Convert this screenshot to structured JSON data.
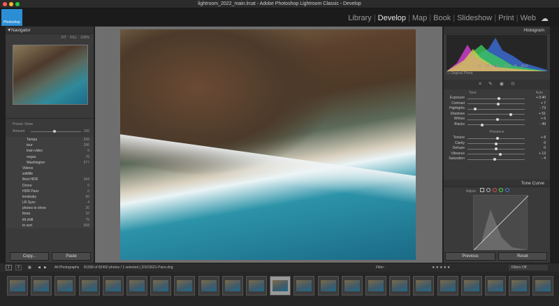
{
  "window": {
    "title": "lightroom_2022_main.lrcat - Adobe Photoshop Lightroom Classic - Develop"
  },
  "logo": {
    "text": "Photoshop"
  },
  "modules": [
    {
      "label": "Library",
      "active": false
    },
    {
      "label": "Develop",
      "active": true
    },
    {
      "label": "Map",
      "active": false
    },
    {
      "label": "Book",
      "active": false
    },
    {
      "label": "Slideshow",
      "active": false
    },
    {
      "label": "Print",
      "active": false
    },
    {
      "label": "Web",
      "active": false
    }
  ],
  "navigator": {
    "title": "Navigator",
    "zoom": [
      "FIT",
      "FILL",
      "100%"
    ]
  },
  "presets": {
    "label": "Preset: None",
    "amount_label": "Amount",
    "amount_value": "100"
  },
  "folders": [
    {
      "name": "Tampa",
      "count": "326"
    },
    {
      "name": "tour",
      "count": "286"
    },
    {
      "name": "train video",
      "count": "6"
    },
    {
      "name": "vegas",
      "count": "76"
    },
    {
      "name": "Washington",
      "count": "977"
    },
    {
      "name": "Videos",
      "count": ""
    },
    {
      "name": "wildlife",
      "count": ""
    },
    {
      "name": "Best HDR",
      "count": "344"
    },
    {
      "name": "Drone",
      "count": "0"
    },
    {
      "name": "HDR Panz",
      "count": "0"
    },
    {
      "name": "lensbaby",
      "count": "60"
    },
    {
      "name": "LR Sync",
      "count": "4"
    },
    {
      "name": "photos to show",
      "count": "20"
    },
    {
      "name": "theta",
      "count": "10"
    },
    {
      "name": "tilt shift",
      "count": "75"
    },
    {
      "name": "to sort",
      "count": "668"
    }
  ],
  "left_buttons": {
    "copy": "Copy...",
    "paste": "Paste"
  },
  "histogram": {
    "title": "Histogram",
    "r": "32.3",
    "g": "39.5",
    "b": "40.8",
    "original_photo": "Original Photo"
  },
  "basic": {
    "tone": "Tone",
    "auto": "Auto",
    "sliders": [
      {
        "label": "Exposure",
        "value": "+ 0.40",
        "pos": 0.55
      },
      {
        "label": "Contrast",
        "value": "+ 7",
        "pos": 0.54
      },
      {
        "label": "Highlights",
        "value": "- 73",
        "pos": 0.14
      },
      {
        "label": "Shadows",
        "value": "+ 51",
        "pos": 0.75
      },
      {
        "label": "Whites",
        "value": "+ 6",
        "pos": 0.53
      },
      {
        "label": "Blacks",
        "value": "- 49",
        "pos": 0.25
      }
    ],
    "presence": "Presence",
    "presence_sliders": [
      {
        "label": "Texture",
        "value": "+ 8",
        "pos": 0.53
      },
      {
        "label": "Clarity",
        "value": "0",
        "pos": 0.5
      },
      {
        "label": "Dehaze",
        "value": "0",
        "pos": 0.5
      },
      {
        "label": "Vibrance",
        "value": "+ 13",
        "pos": 0.57
      },
      {
        "label": "Saturation",
        "value": "- 4",
        "pos": 0.48
      }
    ]
  },
  "tone_curve": {
    "title": "Tone Curve",
    "adjust": "Adjust"
  },
  "right_buttons": {
    "previous": "Previous",
    "reset": "Reset"
  },
  "filmstrip": {
    "pages": [
      "1",
      "2"
    ],
    "source": "All Photographs",
    "info": "81368 of 82460 photos / 1 selected /",
    "filename": "_DSC5621-Pano.dng",
    "filter_label": "Filter :",
    "filters_off": "Filters Off"
  },
  "colors": {
    "accent": "#2c8fd6",
    "panel": "#3a3a3a",
    "bg": "#1e1e1e"
  }
}
